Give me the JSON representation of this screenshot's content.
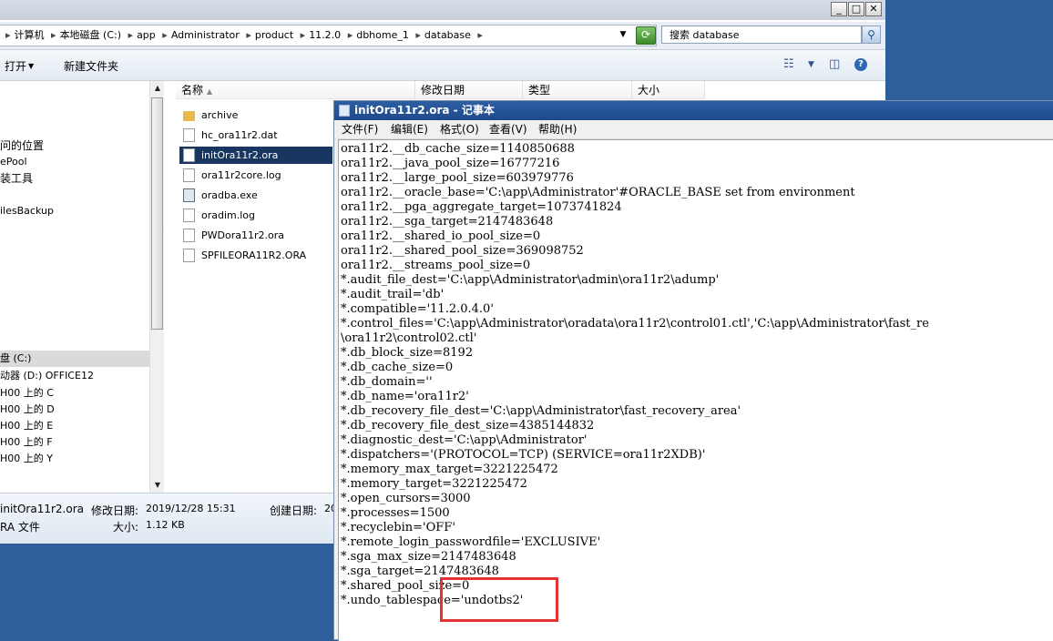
{
  "explorer": {
    "window_buttons": [
      "_",
      "□",
      "✕"
    ],
    "breadcrumb": [
      "计算机",
      "本地磁盘 (C:)",
      "app",
      "Administrator",
      "product",
      "11.2.0",
      "dbhome_1",
      "database"
    ],
    "search_placeholder": "搜索 database",
    "toolbar": {
      "open": "打开",
      "new_folder": "新建文件夹"
    },
    "nav_items": [
      "问的位置",
      "ePool",
      "装工具",
      "ilesBackup",
      "盘 (C:)",
      "动器 (D:) OFFICE12",
      "H00 上的 C",
      "H00 上的 D",
      "H00 上的 E",
      "H00 上的 F",
      "H00 上的 Y"
    ],
    "columns": [
      "名称",
      "修改日期",
      "类型",
      "大小"
    ],
    "files": [
      {
        "name": "archive",
        "type": "folder"
      },
      {
        "name": "hc_ora11r2.dat",
        "type": "file"
      },
      {
        "name": "initOra11r2.ora",
        "type": "file",
        "selected": true
      },
      {
        "name": "ora11r2core.log",
        "type": "file"
      },
      {
        "name": "oradba.exe",
        "type": "exe"
      },
      {
        "name": "oradim.log",
        "type": "file"
      },
      {
        "name": "PWDora11r2.ora",
        "type": "file"
      },
      {
        "name": "SPFILEORA11R2.ORA",
        "type": "file"
      }
    ],
    "details": {
      "filename": "initOra11r2.ora",
      "modified_label": "修改日期:",
      "modified": "2019/12/28 15:31",
      "created_label": "创建日期:",
      "created_fragment": "20",
      "type": "RA 文件",
      "size_label": "大小:",
      "size": "1.12 KB"
    }
  },
  "notepad": {
    "title": "initOra11r2.ora - 记事本",
    "menu": [
      "文件(F)",
      "编辑(E)",
      "格式(O)",
      "查看(V)",
      "帮助(H)"
    ],
    "lines": [
      "ora11r2.__db_cache_size=1140850688",
      "ora11r2.__java_pool_size=16777216",
      "ora11r2.__large_pool_size=603979776",
      "ora11r2.__oracle_base='C:\\app\\Administrator'#ORACLE_BASE set from environment",
      "ora11r2.__pga_aggregate_target=1073741824",
      "ora11r2.__sga_target=2147483648",
      "ora11r2.__shared_io_pool_size=0",
      "ora11r2.__shared_pool_size=369098752",
      "ora11r2.__streams_pool_size=0",
      "*.audit_file_dest='C:\\app\\Administrator\\admin\\ora11r2\\adump'",
      "*.audit_trail='db'",
      "*.compatible='11.2.0.4.0'",
      "*.control_files='C:\\app\\Administrator\\oradata\\ora11r2\\control01.ctl','C:\\app\\Administrator\\fast_re",
      "\\ora11r2\\control02.ctl'",
      "*.db_block_size=8192",
      "*.db_cache_size=0",
      "*.db_domain=''",
      "*.db_name='ora11r2'",
      "*.db_recovery_file_dest='C:\\app\\Administrator\\fast_recovery_area'",
      "*.db_recovery_file_dest_size=4385144832",
      "*.diagnostic_dest='C:\\app\\Administrator'",
      "*.dispatchers='(PROTOCOL=TCP) (SERVICE=ora11r2XDB)'",
      "*.memory_max_target=3221225472",
      "*.memory_target=3221225472",
      "*.open_cursors=3000",
      "*.processes=1500",
      "*.recyclebin='OFF'",
      "*.remote_login_passwordfile='EXCLUSIVE'",
      "*.sga_max_size=2147483648",
      "*.sga_target=2147483648",
      "*.shared_pool_size=0",
      "*.undo_tablespace='undotbs2'"
    ]
  },
  "colors": {
    "highlight": "#e23434",
    "selection": "#18365f"
  }
}
